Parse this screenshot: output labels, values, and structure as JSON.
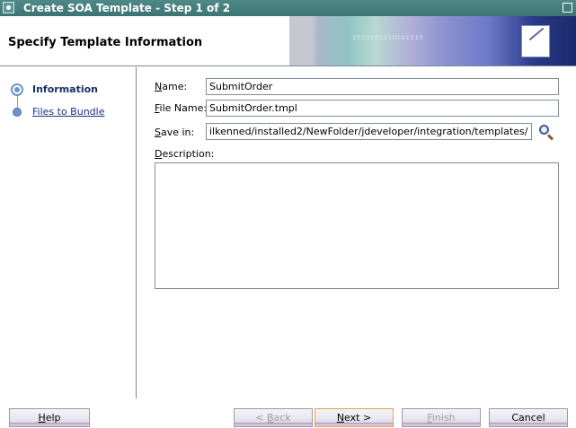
{
  "window": {
    "title": "Create SOA Template - Step 1 of 2"
  },
  "header": {
    "heading": "Specify Template Information",
    "banner_text": "1010101010101010"
  },
  "nav": {
    "items": [
      {
        "label": "Information",
        "state": "current"
      },
      {
        "label": "Files to Bundle",
        "state": "link"
      }
    ]
  },
  "form": {
    "name": {
      "label_mnemonic": "N",
      "label_rest": "ame:",
      "value": "SubmitOrder"
    },
    "file_name": {
      "label_mnemonic": "F",
      "label_rest": "ile Name:",
      "value": "SubmitOrder.tmpl"
    },
    "save_in": {
      "label_mnemonic": "S",
      "label_rest": "ave in:",
      "value": "ilkenned/installed2/NewFolder/jdeveloper/integration/templates/"
    },
    "description": {
      "label_mnemonic": "D",
      "label_rest": "escription:",
      "value": ""
    }
  },
  "buttons": {
    "help": {
      "mnemonic": "H",
      "rest": "elp"
    },
    "back": {
      "prefix": "< ",
      "mnemonic": "B",
      "rest": "ack"
    },
    "next": {
      "mnemonic": "N",
      "rest": "ext >"
    },
    "finish": {
      "mnemonic": "F",
      "rest": "inish"
    },
    "cancel": {
      "label": "Cancel"
    }
  },
  "colors": {
    "titlebar": "#4f8a88",
    "nav_link": "#1a2f8a",
    "default_button_border": "#e8a050"
  }
}
